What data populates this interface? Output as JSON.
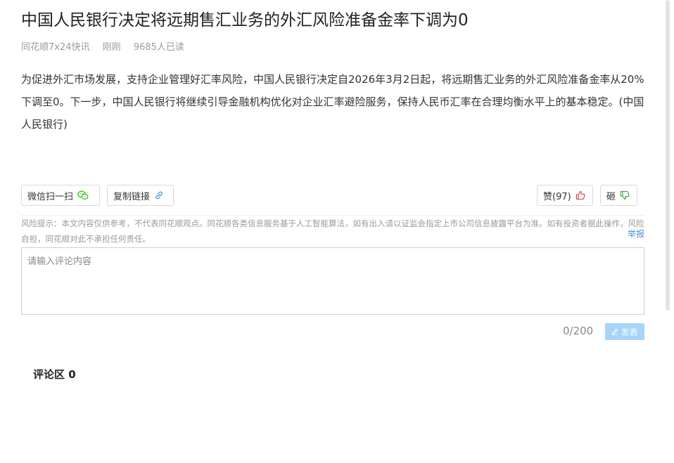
{
  "article": {
    "title": "中国人民银行决定将远期售汇业务的外汇风险准备金率下调为0",
    "source": "同花顺7x24快讯",
    "time": "刚刚",
    "reads": "9685人已读",
    "body": "为促进外汇市场发展，支持企业管理好汇率风险，中国人民银行决定自2026年3月2日起，将远期售汇业务的外汇风险准备金率从20%下调至0。下一步，中国人民银行将继续引导金融机构优化对企业汇率避险服务，保持人民币汇率在合理均衡水平上的基本稳定。(中国人民银行)"
  },
  "actions": {
    "wechat_label": "微信扫一扫",
    "copy_label": "复制链接",
    "like_label": "赞(97)",
    "dislike_label": "砸"
  },
  "risk": {
    "text": "风险提示：本文内容仅供参考，不代表同花顺观点。同花顺各类信息服务基于人工智能算法，如有出入请以证监会指定上市公司信息披露平台为准。如有投资者据此操作，风险自担，同花顺对此不承担任何责任。",
    "report_label": "举报"
  },
  "comment": {
    "placeholder": "请输入评论内容",
    "value": "",
    "counter": "0/200",
    "publish_label": "发表"
  },
  "comments_section": {
    "title": "评论区 0"
  },
  "colors": {
    "wechat": "#2dc100",
    "link": "#4a90d9",
    "like": "#e5383b",
    "dislike": "#2e9e44",
    "publish_bg": "#a7d4f7"
  },
  "icons": {
    "wechat": "wechat-icon",
    "link": "link-icon",
    "like": "thumbs-up-icon",
    "dislike": "thumbs-down-icon",
    "edit": "edit-icon"
  }
}
